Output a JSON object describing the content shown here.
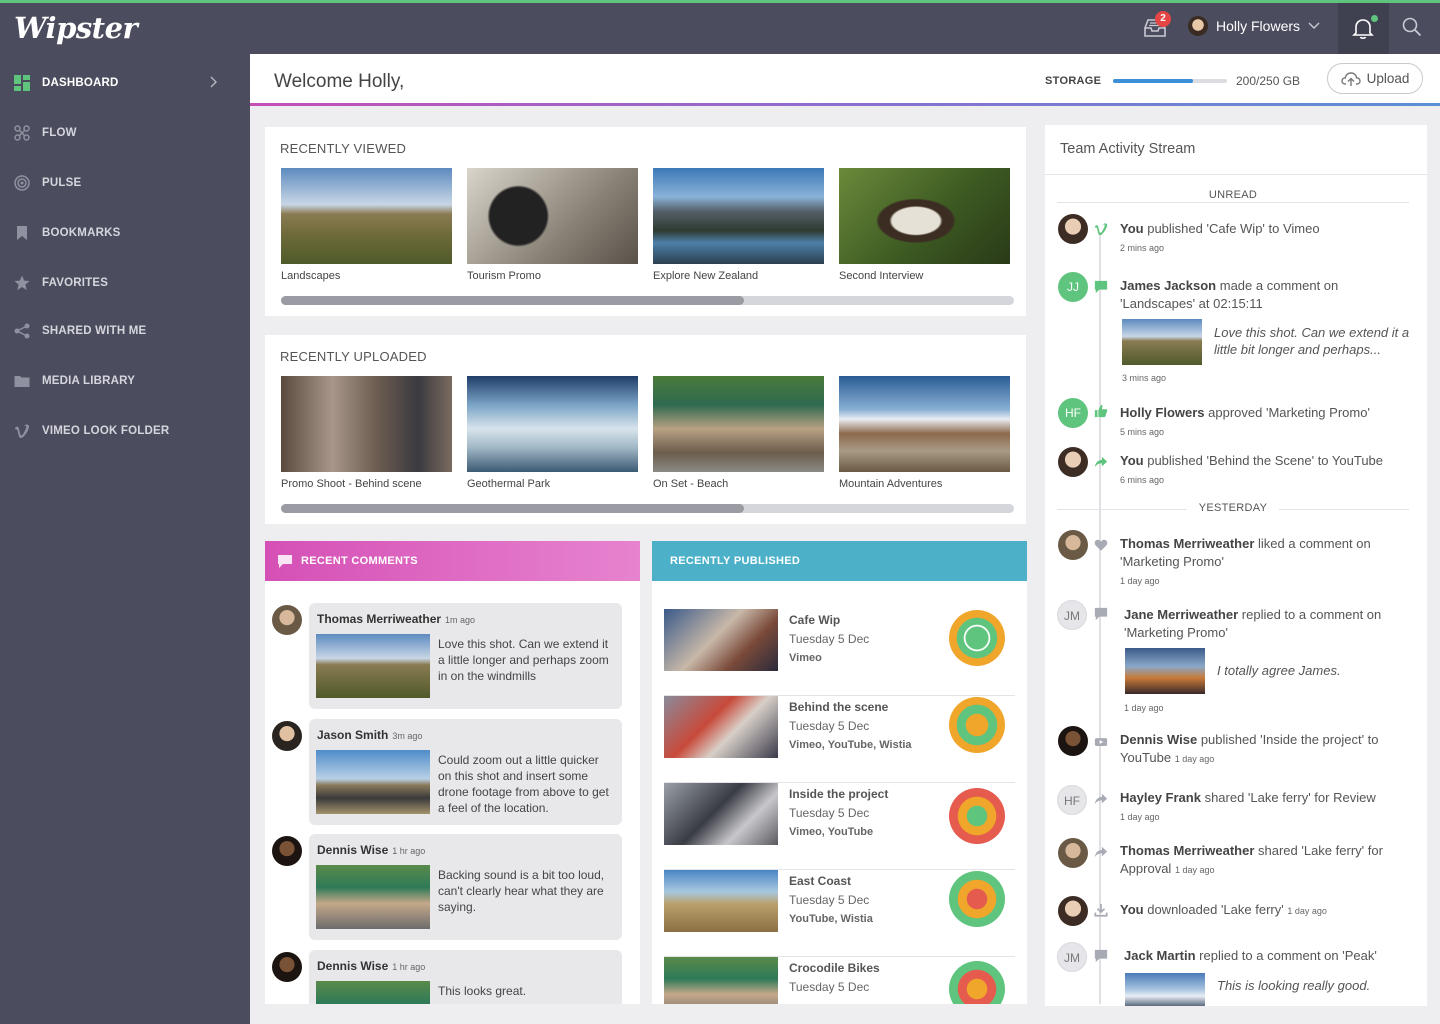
{
  "app": {
    "logo": "Wipster",
    "user_name": "Holly Flowers",
    "inbox_count": "2"
  },
  "sidebar": {
    "items": [
      {
        "label": "DASHBOARD",
        "icon": "dashboard-icon"
      },
      {
        "label": "FLOW",
        "icon": "flow-icon"
      },
      {
        "label": "PULSE",
        "icon": "pulse-icon"
      },
      {
        "label": "BOOKMARKS",
        "icon": "bookmark-icon"
      },
      {
        "label": "FAVORITES",
        "icon": "star-icon"
      },
      {
        "label": "SHARED WITH ME",
        "icon": "share-icon"
      },
      {
        "label": "MEDIA LIBRARY",
        "icon": "folder-icon"
      },
      {
        "label": "VIMEO LOOK FOLDER",
        "icon": "vimeo-icon"
      }
    ]
  },
  "header": {
    "welcome": "Welcome Holly,",
    "storage_label": "STORAGE",
    "storage_value": "200/250 GB",
    "storage_fraction": 0.7,
    "upload_label": "Upload"
  },
  "recently_viewed": {
    "title": "RECENTLY VIEWED",
    "items": [
      "Landscapes",
      "Tourism Promo",
      "Explore New Zealand",
      "Second Interview"
    ]
  },
  "recently_uploaded": {
    "title": "RECENTLY UPLOADED",
    "items": [
      "Promo Shoot - Behind scene",
      "Geothermal Park",
      "On Set - Beach",
      "Mountain Adventures"
    ]
  },
  "recent_comments": {
    "title": "RECENT COMMENTS",
    "items": [
      {
        "name": "Thomas Merriweather",
        "time": "1m ago",
        "text": "Love this shot. Can we extend it a little longer and perhaps zoom in on the windmills"
      },
      {
        "name": "Jason Smith",
        "time": "3m ago",
        "text": "Could zoom out a little quicker on this shot and insert some drone footage from above to get a feel of the location."
      },
      {
        "name": "Dennis Wise",
        "time": "1 hr ago",
        "text": "Backing sound is a bit too loud, can't clearly hear what they are saying."
      },
      {
        "name": "Dennis Wise",
        "time": "1 hr ago",
        "text": "This looks great."
      }
    ]
  },
  "recently_published": {
    "title": "RECENTLY PUBLISHED",
    "items": [
      {
        "title": "Cafe Wip",
        "date": "Tuesday 5 Dec",
        "channels": "Vimeo"
      },
      {
        "title": "Behind the scene",
        "date": "Tuesday 5 Dec",
        "channels": "Vimeo, YouTube, Wistia"
      },
      {
        "title": "Inside the project",
        "date": "Tuesday 5 Dec",
        "channels": "Vimeo, YouTube"
      },
      {
        "title": "East Coast",
        "date": "Tuesday 5 Dec",
        "channels": "YouTube, Wistia"
      },
      {
        "title": "Crocodile Bikes",
        "date": "Tuesday 5 Dec",
        "channels": ""
      }
    ]
  },
  "activity": {
    "title": "Team Activity Stream",
    "unread_label": "UNREAD",
    "yesterday_label": "YESTERDAY",
    "items": [
      {
        "actor": "You",
        "text": "published 'Cafe Wip' to Vimeo",
        "time": "2 mins ago"
      },
      {
        "actor": "James Jackson",
        "initials": "JJ",
        "text": "made a comment on 'Landscapes' at  02:15:11",
        "quote": "Love this shot. Can we extend it a little bit longer and perhaps...",
        "time": "3 mins ago"
      },
      {
        "actor": "Holly Flowers",
        "initials": "HF",
        "text": "approved  'Marketing Promo'",
        "time": "5 mins ago"
      },
      {
        "actor": "You",
        "text": "published  'Behind the Scene' to YouTube",
        "time": "6 mins ago"
      },
      {
        "actor": "Thomas Merriweather",
        "text": "liked a comment on 'Marketing Promo'",
        "time": "1 day ago"
      },
      {
        "actor": "Jane Merriweather",
        "initials": "JM",
        "text": "replied  to a comment on 'Marketing Promo'",
        "quote": "I totally agree James.",
        "time": "1 day ago"
      },
      {
        "actor": "Dennis Wise",
        "text": "published  'Inside the project' to YouTube",
        "time": "1 day ago"
      },
      {
        "actor": "Hayley Frank",
        "initials": "HF",
        "text": "shared  'Lake ferry' for Review",
        "time": "1 day ago"
      },
      {
        "actor": "Thomas Merriweather",
        "text": "shared 'Lake ferry' for Approval",
        "time": "1 day ago"
      },
      {
        "actor": "You",
        "text": "downloaded 'Lake ferry'",
        "time": "1 day ago"
      },
      {
        "actor": "Jack Martin",
        "initials": "JM",
        "text": "replied to a comment on 'Peak'",
        "quote": "This is looking really good."
      }
    ]
  },
  "colors": {
    "accent_green": "#5fc47d",
    "sidebar_bg": "#4b4d5e",
    "comments_pink": "#d95bbf",
    "published_blue": "#4cb0c9",
    "ring_orange": "#f0a52b",
    "ring_red": "#e55c4f"
  }
}
